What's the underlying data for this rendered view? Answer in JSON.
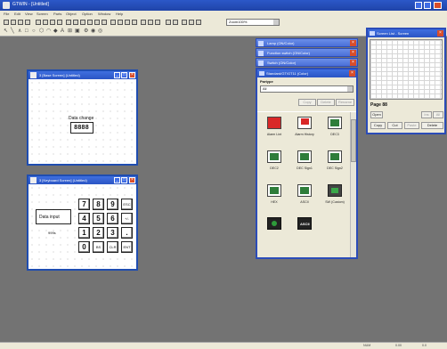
{
  "app": {
    "title": "GTWIN - [Untitled]"
  },
  "menu": [
    "File",
    "Edit",
    "View",
    "Screen",
    "Parts",
    "Object",
    "Option",
    "Window",
    "Help"
  ],
  "toolbar": {
    "zoom_value": "Zoom100%"
  },
  "windows": {
    "base": {
      "title": "3 [Base Screen] (Untitled)",
      "data_change_label": "Data change",
      "data_value": "8888"
    },
    "keyboard": {
      "title": "3 [Keyboard Screen] (Untitled)",
      "data_input_label": "Data input",
      "data_input_value": "999s",
      "keys": [
        [
          "7",
          "8",
          "9",
          "ESC"
        ],
        [
          "4",
          "5",
          "6",
          "+/-"
        ],
        [
          "1",
          "2",
          "3",
          "."
        ],
        [
          "0",
          "BS",
          "CLR",
          "ENT"
        ]
      ]
    }
  },
  "palettes": [
    {
      "title": "Lamp (ON/Color)"
    },
    {
      "title": "Function switch (ON/Color)"
    },
    {
      "title": "Switch (ON/Color)"
    },
    {
      "title": "Standard/GT/GT11 (Color)"
    }
  ],
  "parts_palette": {
    "partype_label": "Partype",
    "partype_value": "All",
    "buttons": [
      "Copy",
      "Delete",
      "Rename"
    ],
    "items": [
      {
        "label": "Alarm Lint",
        "icon": "red-alarm-icon",
        "color": "#d92828"
      },
      {
        "label": "Alarm History",
        "icon": "red-history-icon",
        "color": "#d92828"
      },
      {
        "label": "DEC3",
        "icon": "dec3-icon",
        "color": "#2e7d3a"
      },
      {
        "label": "DEC2",
        "icon": "dec2-icon",
        "color": "#2e7d3a"
      },
      {
        "label": "DEC Sign1",
        "icon": "dec-sign1-icon",
        "color": "#2e7d3a"
      },
      {
        "label": "DEC Sign2",
        "icon": "dec-sign2-icon",
        "color": "#2e7d3a"
      },
      {
        "label": "HEX",
        "icon": "hex-icon",
        "color": "#2e7d3a"
      },
      {
        "label": "ASCII",
        "icon": "ascii-icon",
        "color": "#2e7d3a"
      },
      {
        "label": "SW (Custom)",
        "icon": "sw-custom-icon",
        "color": "#3aa84a"
      },
      {
        "label": "",
        "icon": "lamp-icon",
        "color": "#2e9b3a"
      },
      {
        "label": "",
        "icon": "asc-icon",
        "color": "#2e7d3a",
        "text": "ASCII"
      }
    ]
  },
  "screen_list": {
    "title": "Screen List - Screen",
    "page_label": "Page 88",
    "buttons": [
      "Open",
      "Copy",
      "Cut",
      "Paste",
      "Delete",
      "Ins",
      "All"
    ]
  },
  "status": [
    "NUM",
    "0.00",
    "0.0"
  ]
}
